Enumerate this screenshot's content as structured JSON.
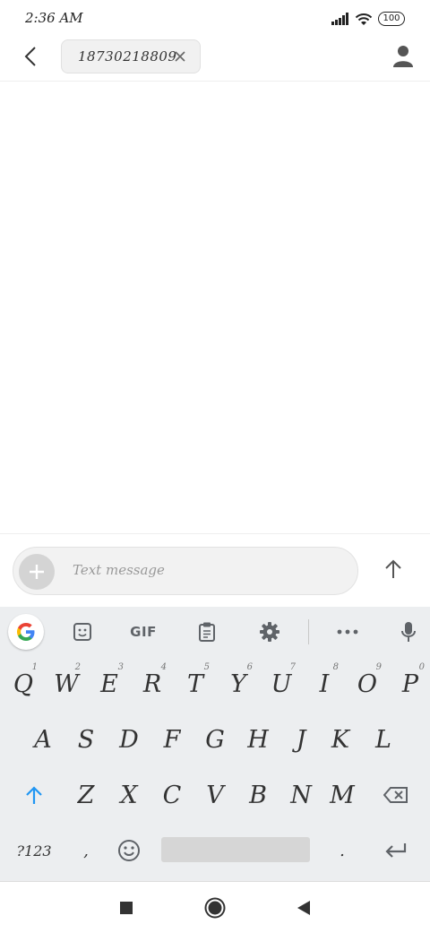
{
  "status_bar": {
    "time": "2:36 AM",
    "battery": "100"
  },
  "top_bar": {
    "recipient_chip": "18730218809"
  },
  "compose": {
    "placeholder": "Text message"
  },
  "keyboard": {
    "toolbar": {
      "gif_label": "GIF"
    },
    "row1": [
      {
        "label": "Q",
        "hint": "1"
      },
      {
        "label": "W",
        "hint": "2"
      },
      {
        "label": "E",
        "hint": "3"
      },
      {
        "label": "R",
        "hint": "4"
      },
      {
        "label": "T",
        "hint": "5"
      },
      {
        "label": "Y",
        "hint": "6"
      },
      {
        "label": "U",
        "hint": "7"
      },
      {
        "label": "I",
        "hint": "8"
      },
      {
        "label": "O",
        "hint": "9"
      },
      {
        "label": "P",
        "hint": "0"
      }
    ],
    "row2": [
      "A",
      "S",
      "D",
      "F",
      "G",
      "H",
      "J",
      "K",
      "L"
    ],
    "row3": [
      "Z",
      "X",
      "C",
      "V",
      "B",
      "N",
      "M"
    ],
    "row4": {
      "symbols": "?123",
      "comma": ",",
      "period": "."
    }
  }
}
